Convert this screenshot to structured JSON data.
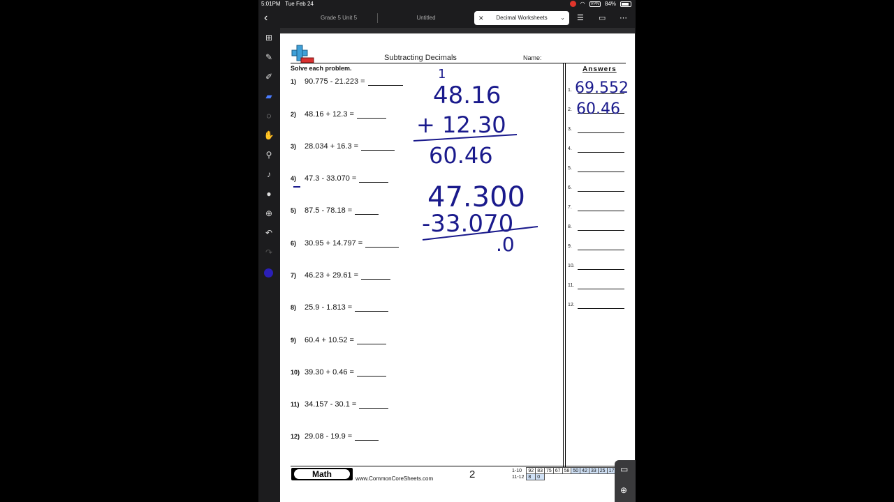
{
  "status": {
    "time": "5:01PM",
    "date": "Tue Feb 24",
    "vpn": "VPN",
    "battery": "84%"
  },
  "tabs": [
    {
      "label": "Grade 5 Unit 5"
    },
    {
      "label": "Untitled"
    },
    {
      "label": "Decimal Worksheets"
    }
  ],
  "icons": {
    "back": "chevron-left-icon",
    "list": "list-icon",
    "pages": "pages-icon",
    "more": "more-icon",
    "tools": [
      "grid-icon",
      "pen-icon",
      "highlighter-icon",
      "eraser-icon",
      "lasso-icon",
      "hand-icon",
      "eyedropper-icon",
      "mic-icon",
      "sticker-icon",
      "add-icon",
      "undo-icon",
      "redo-icon"
    ]
  },
  "colors": {
    "active_tool": "#4a7cff",
    "ink": "#1a1a8c",
    "pen_color": "#2b1fb8"
  },
  "worksheet": {
    "title": "Subtracting Decimals",
    "name_label": "Name:",
    "instructions": "Solve each problem.",
    "problems": [
      {
        "num": "1)",
        "expr": "90.775 - 21.223  ="
      },
      {
        "num": "2)",
        "expr": "48.16 + 12.3  ="
      },
      {
        "num": "3)",
        "expr": "28.034 + 16.3  ="
      },
      {
        "num": "4)",
        "expr": "47.3 - 33.070  ="
      },
      {
        "num": "5)",
        "expr": "87.5 - 78.18  ="
      },
      {
        "num": "6)",
        "expr": "30.95 + 14.797  ="
      },
      {
        "num": "7)",
        "expr": "46.23 + 29.61  ="
      },
      {
        "num": "8)",
        "expr": "25.9 - 1.813  ="
      },
      {
        "num": "9)",
        "expr": "60.4 + 10.52  ="
      },
      {
        "num": "10)",
        "expr": "39.30 + 0.46  ="
      },
      {
        "num": "11)",
        "expr": "34.157 - 30.1  ="
      },
      {
        "num": "12)",
        "expr": "29.08 - 19.9  ="
      }
    ],
    "answers_title": "Answers",
    "answer_nums": [
      "1.",
      "2.",
      "3.",
      "4.",
      "5.",
      "6.",
      "7.",
      "8.",
      "9.",
      "10.",
      "11.",
      "12."
    ],
    "handwritten_answers": [
      "69.552",
      "60.46"
    ],
    "scratch": {
      "carry": "1",
      "top1": "48.16",
      "mid1": "+ 12.30",
      "result1": "60.46",
      "top2": "47.300",
      "mid2": "-33.070",
      "result2": ".0"
    },
    "footer": {
      "subject": "Math",
      "site": "www.CommonCoreSheets.com",
      "page": "2",
      "score_rows": [
        {
          "label": "1-10",
          "cells": [
            "92",
            "83",
            "75",
            "67",
            "58",
            "50",
            "42",
            "33",
            "25",
            "17"
          ]
        },
        {
          "label": "11-12",
          "cells": [
            "8",
            "0"
          ]
        }
      ]
    }
  }
}
